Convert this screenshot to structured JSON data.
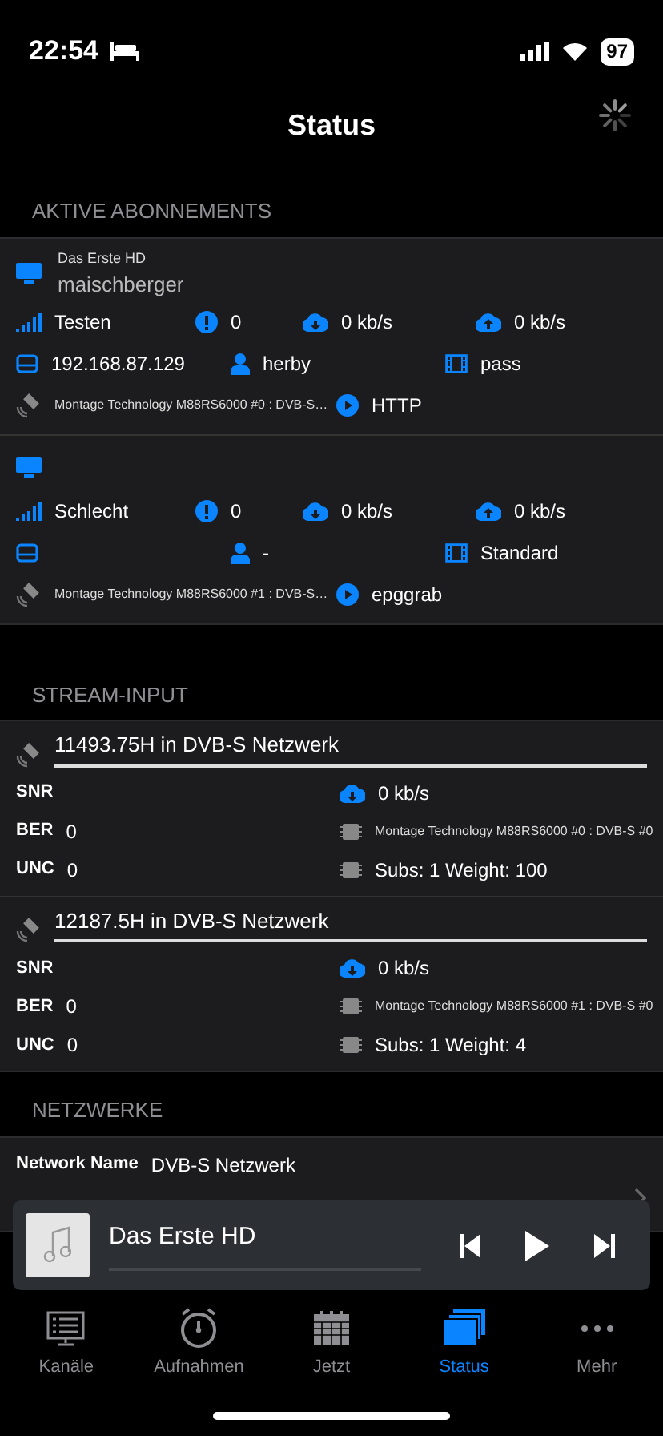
{
  "status_bar": {
    "time": "22:54",
    "battery": "97"
  },
  "header": {
    "title": "Status"
  },
  "subscriptions_section": {
    "title": "AKTIVE ABONNEMENTS",
    "items": [
      {
        "channel": "Das Erste HD",
        "program": "maischberger",
        "signal": "Testen",
        "errors": "0",
        "down": "0 kb/s",
        "up": "0 kb/s",
        "ip": "192.168.87.129",
        "user": "herby",
        "profile": "pass",
        "tuner": "Montage Technology M88RS6000 #0 : DVB-S…",
        "protocol": "HTTP"
      },
      {
        "signal": "Schlecht",
        "errors": "0",
        "down": "0 kb/s",
        "up": "0 kb/s",
        "user": "-",
        "profile": "Standard",
        "tuner": "Montage Technology M88RS6000 #1 : DVB-S…",
        "protocol": "epggrab"
      }
    ]
  },
  "stream_section": {
    "title": "STREAM-INPUT",
    "items": [
      {
        "title": "11493.75H in DVB-S Netzwerk",
        "snr_label": "SNR",
        "down": "0 kb/s",
        "ber_label": "BER",
        "ber": "0",
        "tuner": "Montage Technology M88RS6000 #0 : DVB-S #0",
        "unc_label": "UNC",
        "unc": "0",
        "subs": "Subs: 1 Weight: 100"
      },
      {
        "title": "12187.5H in DVB-S Netzwerk",
        "snr_label": "SNR",
        "down": "0 kb/s",
        "ber_label": "BER",
        "ber": "0",
        "tuner": "Montage Technology M88RS6000 #1 : DVB-S #0",
        "unc_label": "UNC",
        "unc": "0",
        "subs": "Subs: 1 Weight: 4"
      }
    ]
  },
  "network_section": {
    "title": "NETZWERKE",
    "label": "Network Name",
    "value": "DVB-S Netzwerk"
  },
  "player": {
    "title": "Das Erste HD"
  },
  "tabs": [
    {
      "label": "Kanäle",
      "selected": false
    },
    {
      "label": "Aufnahmen",
      "selected": false
    },
    {
      "label": "Jetzt",
      "selected": false
    },
    {
      "label": "Status",
      "selected": true
    },
    {
      "label": "Mehr",
      "selected": false
    }
  ]
}
